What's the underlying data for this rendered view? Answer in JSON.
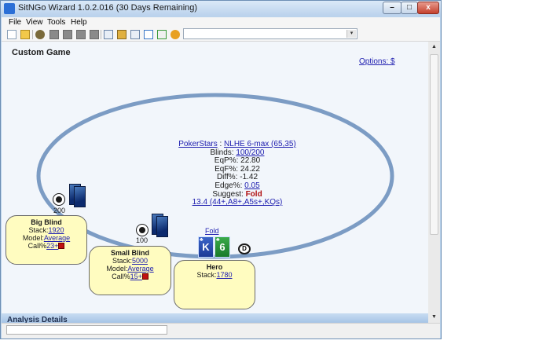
{
  "window": {
    "title": "SitNGo Wizard 1.0.2.016 (30 Days Remaining)",
    "controls": {
      "minimize": "–",
      "maximize": "□",
      "close": "x"
    }
  },
  "menu": [
    "File",
    "View",
    "Tools",
    "Help"
  ],
  "toolbar": {
    "combo_value": "",
    "combo_arrow": "▾"
  },
  "page": {
    "title": "Custom Game",
    "options_link": "Options: $"
  },
  "info": {
    "site": "PokerStars",
    "site_sep": " : ",
    "game": "NLHE 6-max (65,35)",
    "rows": [
      {
        "label": "Blinds: ",
        "value": "100/200",
        "link": true
      },
      {
        "label": "EqP%: ",
        "value": "22.80"
      },
      {
        "label": "EqF%: ",
        "value": "24.22"
      },
      {
        "label": "Diff%: ",
        "value": "-1.42"
      },
      {
        "label": "Edge%: ",
        "value": "0.05",
        "link": true
      }
    ],
    "suggest_label": "Suggest: ",
    "suggest_value": "Fold",
    "range": "13.4 (44+,A8+,A5s+,KQs)"
  },
  "seats": {
    "big_blind": {
      "name": "Big Blind",
      "stack_label": "Stack:",
      "stack": "1920",
      "model_label": "Model:",
      "model": "Average",
      "call_label": "Call%",
      "call": "23+",
      "chips": "200"
    },
    "small_blind": {
      "name": "Small Blind",
      "stack_label": "Stack:",
      "stack": "5000",
      "model_label": "Model:",
      "model": "Average",
      "call_label": "Call%",
      "call": "15+",
      "chips": "100"
    },
    "hero": {
      "name": "Hero",
      "stack_label": "Stack:",
      "stack": "1780",
      "action": "Fold",
      "cards": [
        {
          "rank": "K",
          "suit": "♣"
        },
        {
          "rank": "6",
          "suit": "♣"
        }
      ],
      "dealer_button": "D"
    }
  },
  "panel": {
    "title": "Analysis Details"
  },
  "scrollbar": {
    "up": "▲",
    "down": "▼"
  },
  "colors": {
    "table_rail": "#7c9cc4",
    "seat_box": "#fffcc0",
    "link": "#2020b0",
    "fold": "#b01010"
  }
}
